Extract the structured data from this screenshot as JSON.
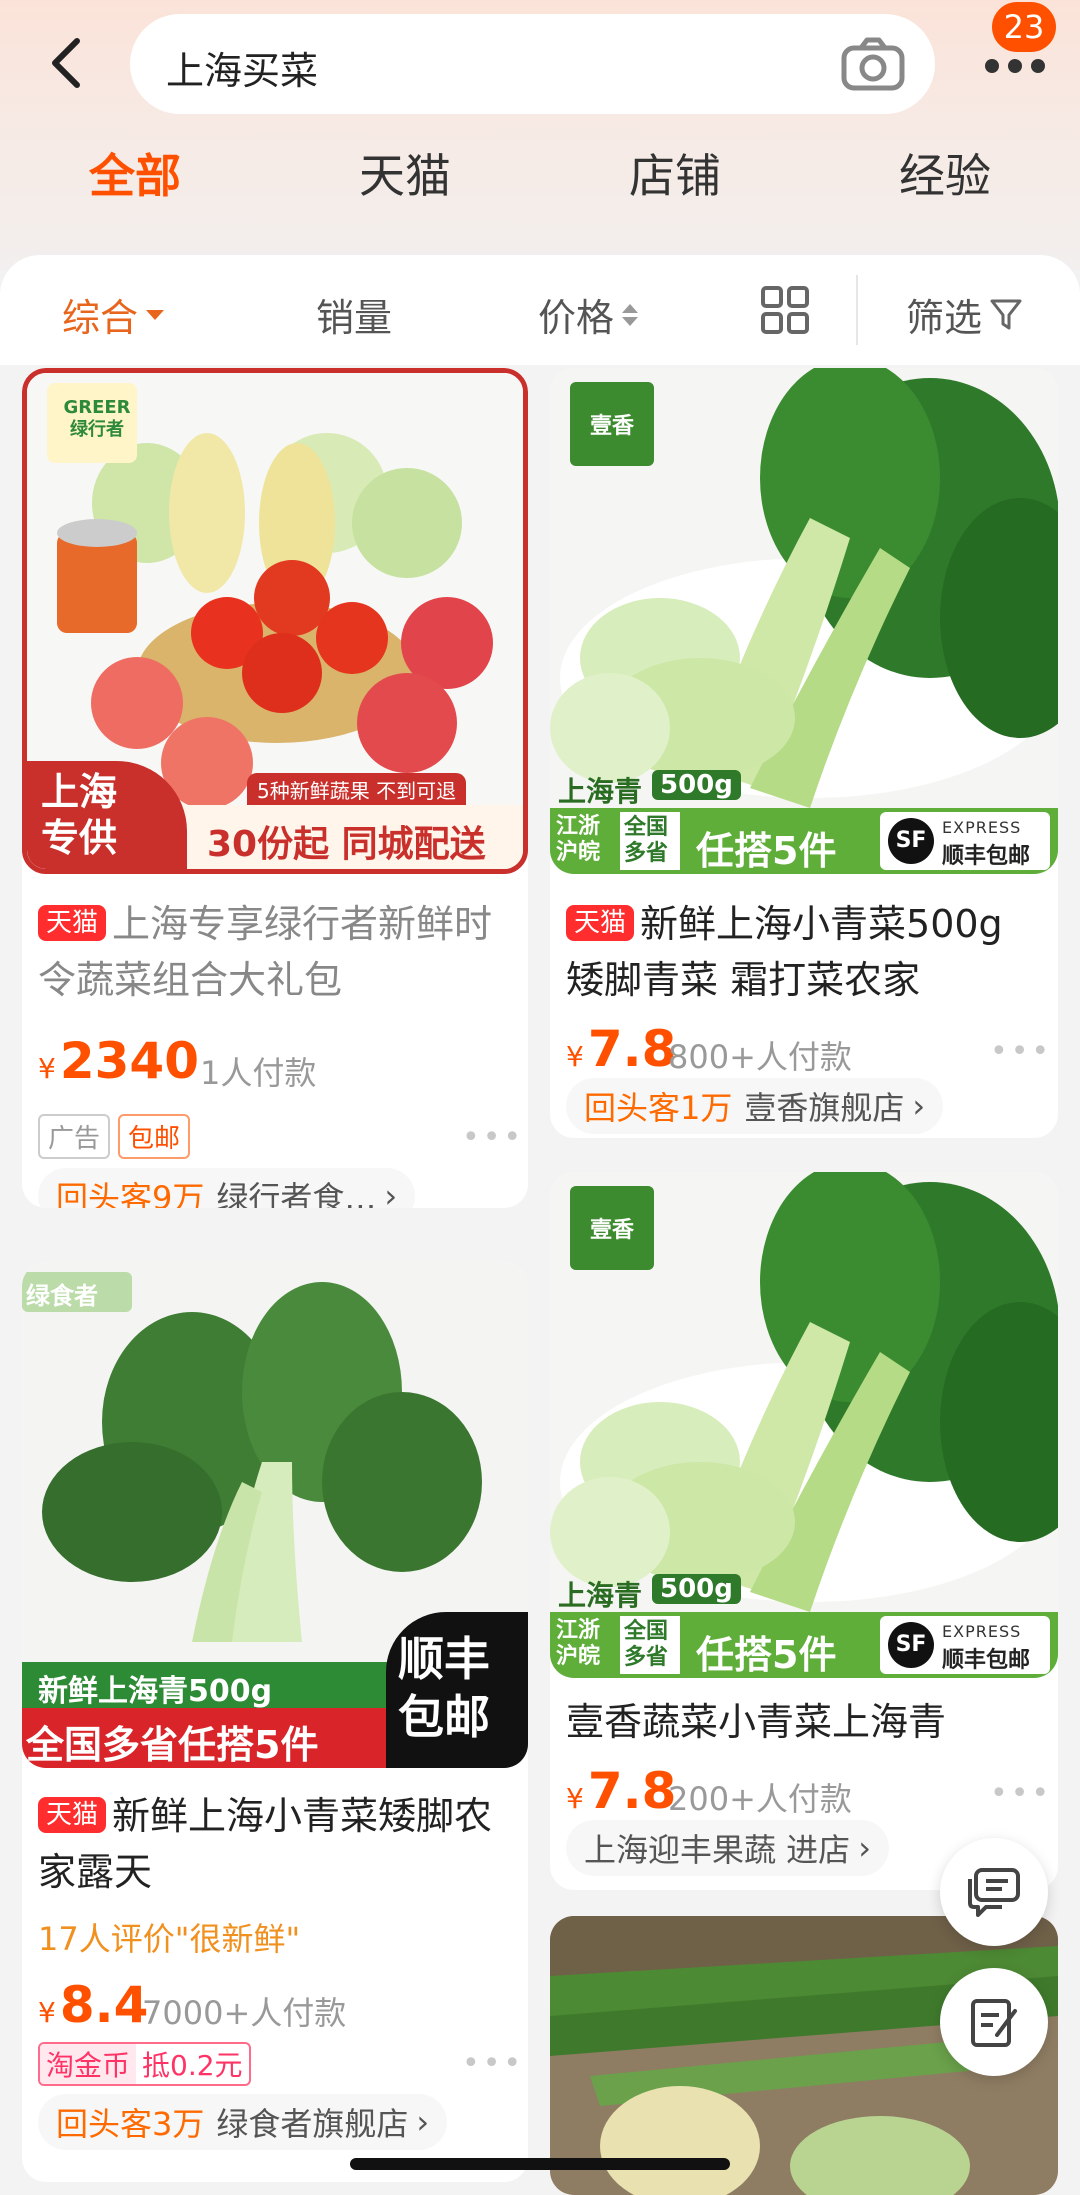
{
  "header": {
    "search_query": "上海买菜",
    "badge_count": "23",
    "tabs": [
      "全部",
      "天猫",
      "店铺",
      "经验"
    ],
    "active_tab": "全部"
  },
  "sort": {
    "comprehensive": "综合",
    "sales": "销量",
    "price": "价格",
    "filter": "筛选"
  },
  "products": [
    {
      "badge": "天猫",
      "title": "上海专享绿行者新鲜时令蔬菜组合大礼包",
      "price": "2340",
      "currency": "¥",
      "sales": "1人付款",
      "tags": [
        "广告",
        "包邮"
      ],
      "repeat": "回头客9万",
      "shop": "绿行者食…",
      "image": {
        "brand": "GREER",
        "brand_cn": "绿行者",
        "corner": "上海\n专供",
        "ribbon_small": "5种新鲜蔬果 不到可退",
        "ribbon": "30份起 同城配送"
      }
    },
    {
      "badge": "天猫",
      "title": "新鲜上海小青菜500g 矮脚青菜 霜打菜农家",
      "price": "7.8",
      "currency": "¥",
      "sales": "800+人付款",
      "repeat": "回头客1万",
      "shop": "壹香旗舰店",
      "image": {
        "logo": "壹香",
        "label": "上海青",
        "weight": "500g",
        "region1": "江浙\n沪皖",
        "region2": "全国\n多省",
        "promo": "任搭5件",
        "express": "EXPRESS",
        "sf": "顺丰包邮"
      }
    },
    {
      "badge": "天猫",
      "title": "新鲜上海小青菜矮脚农家露天",
      "price": "8.4",
      "currency": "¥",
      "sales": "7000+人付款",
      "review": "17人评价\"很新鲜\"",
      "coin_left": "淘金币",
      "coin_right": "抵0.2元",
      "repeat": "回头客3万",
      "shop": "绿食者旗舰店",
      "image": {
        "logo": "绿食者",
        "line1": "新鲜上海青500g",
        "line2": "全国多省任搭5件",
        "corner": "顺丰\n包邮"
      }
    },
    {
      "title": "壹香蔬菜小青菜上海青",
      "price": "7.8",
      "currency": "¥",
      "sales": "200+人付款",
      "shop": "上海迎丰果蔬 进店",
      "image": {
        "logo": "壹香",
        "label": "上海青",
        "weight": "500g",
        "region1": "江浙\n沪皖",
        "region2": "全国\n多省",
        "promo": "任搭5件",
        "express": "EXPRESS",
        "sf": "顺丰包邮"
      }
    }
  ],
  "colors": {
    "accent": "#ff5000",
    "tmall": "#ff2d2d",
    "sort_active": "#e8651d"
  }
}
